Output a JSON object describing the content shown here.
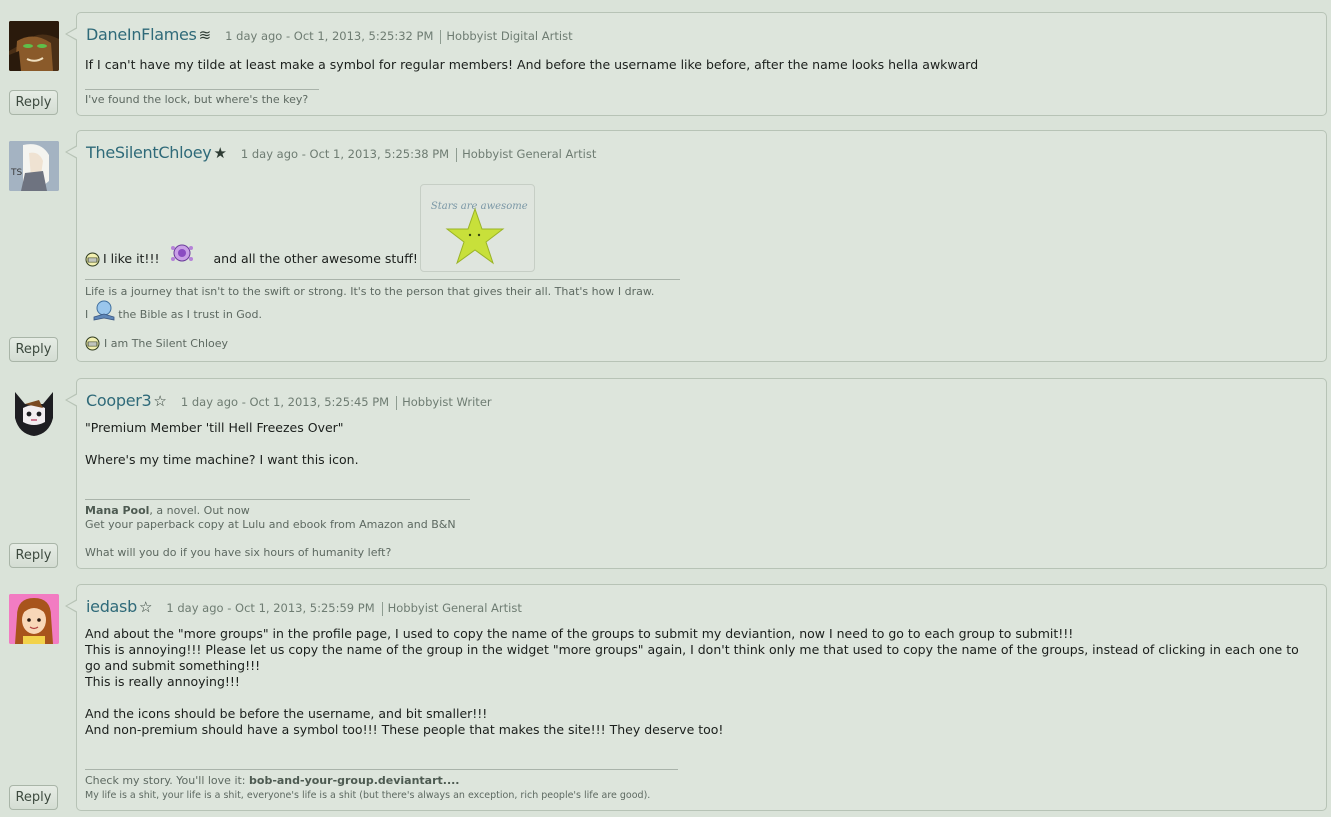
{
  "reply_label": "Reply",
  "comments": [
    {
      "username": "DaneInFlames",
      "symbol": "≋",
      "timestamp": "1 day ago - Oct 1, 2013, 5:25:32 PM",
      "role": "Hobbyist Digital Artist",
      "body": "If I can't have my tilde at least make a symbol for regular members! And before the username like before, after the name looks hella awkward",
      "signature": "I've found the lock, but where's the key?"
    },
    {
      "username": "TheSilentChloey",
      "symbol": "★",
      "timestamp": "1 day ago - Oct 1, 2013, 5:25:38 PM",
      "role": "Hobbyist General Artist",
      "body_part1": "I like it!!!",
      "body_part2": "and all the other awesome stuff!",
      "image_caption": "Stars are awesome",
      "signature_line1": "Life is a journey that isn't to the swift or strong. It's to the person that gives their all. That's how I draw.",
      "signature_line2_pre": "I",
      "signature_line2_post": "the Bible as I trust in God.",
      "signature_line3": "I am The Silent Chloey"
    },
    {
      "username": "Cooper3",
      "symbol": "☆",
      "timestamp": "1 day ago - Oct 1, 2013, 5:25:45 PM",
      "role": "Hobbyist Writer",
      "body_line1": "\"Premium Member 'till Hell Freezes Over\"",
      "body_line2": "Where's my time machine? I want this icon.",
      "signature_title": "Mana Pool",
      "signature_title_suffix": ", a novel. Out now",
      "signature_line2": "Get your paperback copy at Lulu and ebook from Amazon and B&N",
      "signature_line3": "What will you do if you have six hours of humanity left?"
    },
    {
      "username": "iedasb",
      "symbol": "☆",
      "timestamp": "1 day ago - Oct 1, 2013, 5:25:59 PM",
      "role": "Hobbyist General Artist",
      "body_line1": "And about the \"more groups\" in the profile page, I used to copy the name of the groups to submit my deviantion, now I need to go to each group to submit!!!",
      "body_line2": "This is annoying!!! Please let us copy the name of the group in the widget \"more groups\" again, I don't think only me that used to copy the name of the groups, instead of clicking in each one to go and submit something!!!",
      "body_line3": "This is really annoying!!!",
      "body_line4": "And the icons should be before the username, and bit smaller!!!",
      "body_line5": "And non-premium should have a symbol too!!! These people that makes the site!!! They deserve too!",
      "signature_pre": "Check my story. You'll love it:",
      "signature_link": "bob-and-your-group.deviantart....",
      "signature_line2": "My life is a shit, your life is a shit, everyone's life is a shit (but there's always an exception, rich people's life are good)."
    }
  ],
  "colors": {
    "background": "#dae3d9",
    "username": "#2f6a79",
    "bubble": "#dde5dc",
    "border": "#b7c3b6"
  }
}
